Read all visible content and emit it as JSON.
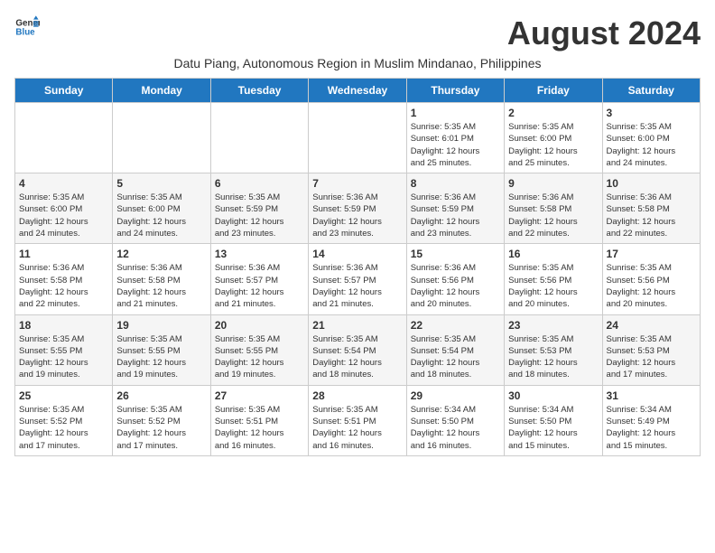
{
  "header": {
    "logo_line1": "General",
    "logo_line2": "Blue",
    "month_title": "August 2024",
    "subtitle": "Datu Piang, Autonomous Region in Muslim Mindanao, Philippines"
  },
  "weekdays": [
    "Sunday",
    "Monday",
    "Tuesday",
    "Wednesday",
    "Thursday",
    "Friday",
    "Saturday"
  ],
  "weeks": [
    [
      {
        "day": "",
        "info": ""
      },
      {
        "day": "",
        "info": ""
      },
      {
        "day": "",
        "info": ""
      },
      {
        "day": "",
        "info": ""
      },
      {
        "day": "1",
        "info": "Sunrise: 5:35 AM\nSunset: 6:01 PM\nDaylight: 12 hours\nand 25 minutes."
      },
      {
        "day": "2",
        "info": "Sunrise: 5:35 AM\nSunset: 6:00 PM\nDaylight: 12 hours\nand 25 minutes."
      },
      {
        "day": "3",
        "info": "Sunrise: 5:35 AM\nSunset: 6:00 PM\nDaylight: 12 hours\nand 24 minutes."
      }
    ],
    [
      {
        "day": "4",
        "info": "Sunrise: 5:35 AM\nSunset: 6:00 PM\nDaylight: 12 hours\nand 24 minutes."
      },
      {
        "day": "5",
        "info": "Sunrise: 5:35 AM\nSunset: 6:00 PM\nDaylight: 12 hours\nand 24 minutes."
      },
      {
        "day": "6",
        "info": "Sunrise: 5:35 AM\nSunset: 5:59 PM\nDaylight: 12 hours\nand 23 minutes."
      },
      {
        "day": "7",
        "info": "Sunrise: 5:36 AM\nSunset: 5:59 PM\nDaylight: 12 hours\nand 23 minutes."
      },
      {
        "day": "8",
        "info": "Sunrise: 5:36 AM\nSunset: 5:59 PM\nDaylight: 12 hours\nand 23 minutes."
      },
      {
        "day": "9",
        "info": "Sunrise: 5:36 AM\nSunset: 5:58 PM\nDaylight: 12 hours\nand 22 minutes."
      },
      {
        "day": "10",
        "info": "Sunrise: 5:36 AM\nSunset: 5:58 PM\nDaylight: 12 hours\nand 22 minutes."
      }
    ],
    [
      {
        "day": "11",
        "info": "Sunrise: 5:36 AM\nSunset: 5:58 PM\nDaylight: 12 hours\nand 22 minutes."
      },
      {
        "day": "12",
        "info": "Sunrise: 5:36 AM\nSunset: 5:58 PM\nDaylight: 12 hours\nand 21 minutes."
      },
      {
        "day": "13",
        "info": "Sunrise: 5:36 AM\nSunset: 5:57 PM\nDaylight: 12 hours\nand 21 minutes."
      },
      {
        "day": "14",
        "info": "Sunrise: 5:36 AM\nSunset: 5:57 PM\nDaylight: 12 hours\nand 21 minutes."
      },
      {
        "day": "15",
        "info": "Sunrise: 5:36 AM\nSunset: 5:56 PM\nDaylight: 12 hours\nand 20 minutes."
      },
      {
        "day": "16",
        "info": "Sunrise: 5:35 AM\nSunset: 5:56 PM\nDaylight: 12 hours\nand 20 minutes."
      },
      {
        "day": "17",
        "info": "Sunrise: 5:35 AM\nSunset: 5:56 PM\nDaylight: 12 hours\nand 20 minutes."
      }
    ],
    [
      {
        "day": "18",
        "info": "Sunrise: 5:35 AM\nSunset: 5:55 PM\nDaylight: 12 hours\nand 19 minutes."
      },
      {
        "day": "19",
        "info": "Sunrise: 5:35 AM\nSunset: 5:55 PM\nDaylight: 12 hours\nand 19 minutes."
      },
      {
        "day": "20",
        "info": "Sunrise: 5:35 AM\nSunset: 5:55 PM\nDaylight: 12 hours\nand 19 minutes."
      },
      {
        "day": "21",
        "info": "Sunrise: 5:35 AM\nSunset: 5:54 PM\nDaylight: 12 hours\nand 18 minutes."
      },
      {
        "day": "22",
        "info": "Sunrise: 5:35 AM\nSunset: 5:54 PM\nDaylight: 12 hours\nand 18 minutes."
      },
      {
        "day": "23",
        "info": "Sunrise: 5:35 AM\nSunset: 5:53 PM\nDaylight: 12 hours\nand 18 minutes."
      },
      {
        "day": "24",
        "info": "Sunrise: 5:35 AM\nSunset: 5:53 PM\nDaylight: 12 hours\nand 17 minutes."
      }
    ],
    [
      {
        "day": "25",
        "info": "Sunrise: 5:35 AM\nSunset: 5:52 PM\nDaylight: 12 hours\nand 17 minutes."
      },
      {
        "day": "26",
        "info": "Sunrise: 5:35 AM\nSunset: 5:52 PM\nDaylight: 12 hours\nand 17 minutes."
      },
      {
        "day": "27",
        "info": "Sunrise: 5:35 AM\nSunset: 5:51 PM\nDaylight: 12 hours\nand 16 minutes."
      },
      {
        "day": "28",
        "info": "Sunrise: 5:35 AM\nSunset: 5:51 PM\nDaylight: 12 hours\nand 16 minutes."
      },
      {
        "day": "29",
        "info": "Sunrise: 5:34 AM\nSunset: 5:50 PM\nDaylight: 12 hours\nand 16 minutes."
      },
      {
        "day": "30",
        "info": "Sunrise: 5:34 AM\nSunset: 5:50 PM\nDaylight: 12 hours\nand 15 minutes."
      },
      {
        "day": "31",
        "info": "Sunrise: 5:34 AM\nSunset: 5:49 PM\nDaylight: 12 hours\nand 15 minutes."
      }
    ]
  ]
}
